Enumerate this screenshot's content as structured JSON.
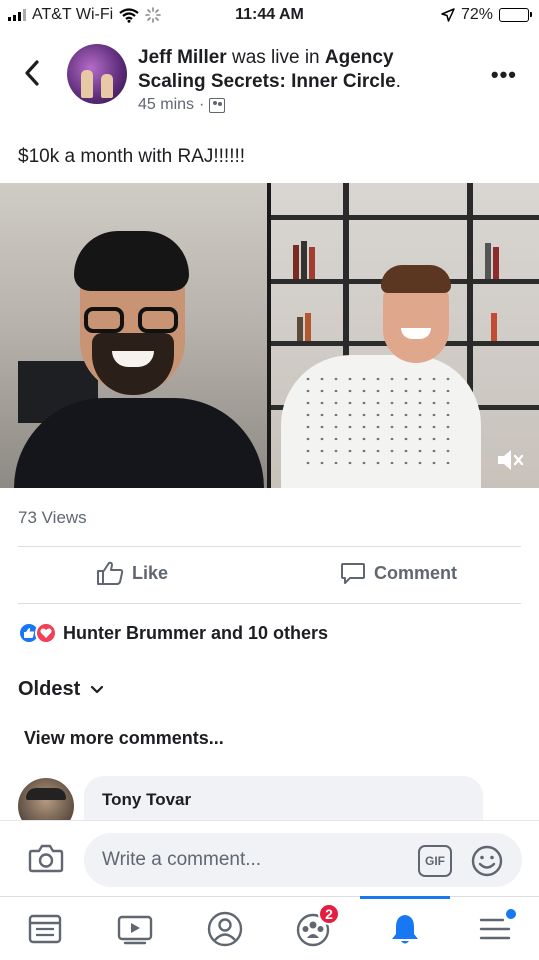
{
  "status_bar": {
    "carrier": "AT&T Wi-Fi",
    "time": "11:44 AM",
    "battery": "72%",
    "battery_level": 0.72
  },
  "post": {
    "author": "Jeff Miller",
    "action": " was live in ",
    "group": "Agency Scaling Secrets: Inner Circle",
    "group_suffix": ".",
    "time_ago": "45 mins",
    "time_separator": "·",
    "text": "$10k a month with RAJ!!!!!!",
    "views": "73 Views"
  },
  "actions": {
    "like": "Like",
    "comment": "Comment"
  },
  "reactions": {
    "summary": "Hunter Brummer and 10 others"
  },
  "comments": {
    "sort_label": "Oldest",
    "view_more": "View more comments...",
    "items": [
      {
        "author": "Tony Tovar"
      }
    ]
  },
  "composer": {
    "placeholder": "Write a comment...",
    "gif_label": "GIF"
  },
  "tabbar": {
    "notification_badge": "2",
    "active_tab": "notifications"
  },
  "colors": {
    "accent": "#1877f2",
    "badge": "#e41e3f",
    "love": "#f33e58",
    "secondary_text": "#606770"
  }
}
